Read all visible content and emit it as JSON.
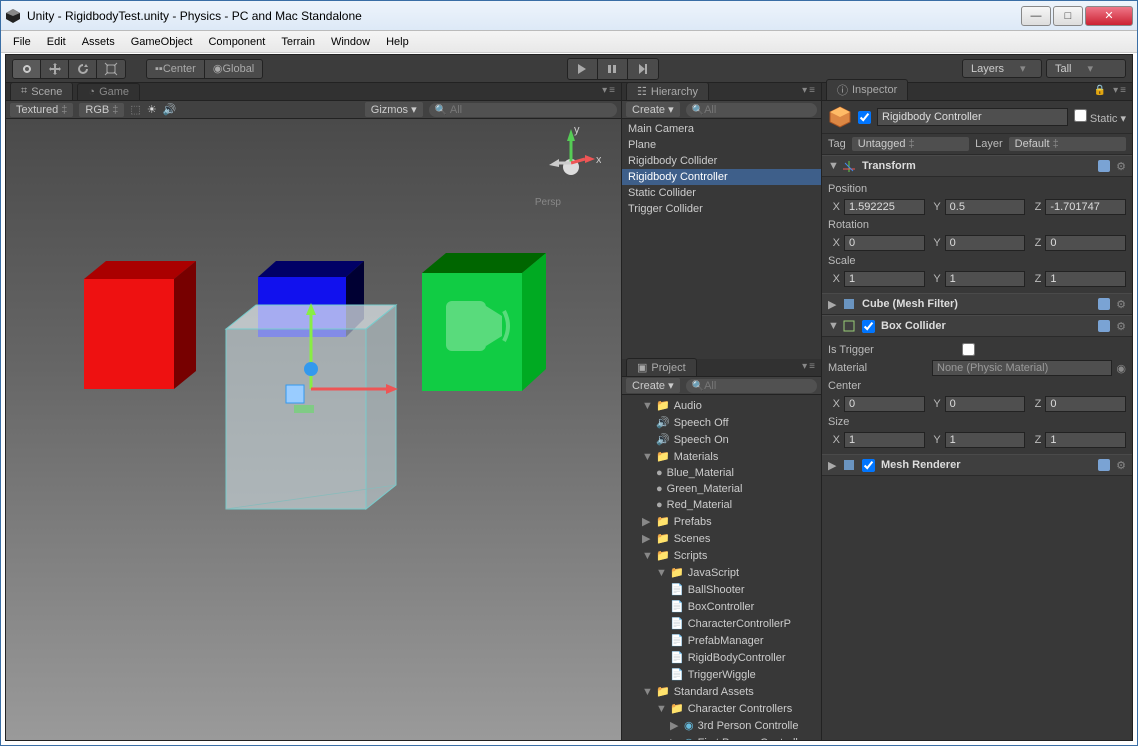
{
  "window": {
    "title": "Unity - RigidbodyTest.unity - Physics - PC and Mac Standalone"
  },
  "menu": [
    "File",
    "Edit",
    "Assets",
    "GameObject",
    "Component",
    "Terrain",
    "Window",
    "Help"
  ],
  "toolbar": {
    "center": "Center",
    "global": "Global",
    "layers": "Layers",
    "layout": "Tall"
  },
  "scene": {
    "tab_scene": "Scene",
    "tab_game": "Game",
    "shading": "Textured",
    "render": "RGB",
    "gizmos": "Gizmos",
    "search_placeholder": "All",
    "persp": "Persp",
    "axis_x": "x",
    "axis_y": "y"
  },
  "hierarchy": {
    "title": "Hierarchy",
    "create": "Create",
    "search_placeholder": "All",
    "items": [
      {
        "label": "Main Camera"
      },
      {
        "label": "Plane"
      },
      {
        "label": "Rigidbody Collider"
      },
      {
        "label": "Rigidbody Controller",
        "selected": true
      },
      {
        "label": "Static Collider"
      },
      {
        "label": "Trigger Collider"
      }
    ]
  },
  "project": {
    "title": "Project",
    "create": "Create",
    "search_placeholder": "All",
    "tree": {
      "audio": "Audio",
      "speech_off": "Speech Off",
      "speech_on": "Speech On",
      "materials": "Materials",
      "blue_mat": "Blue_Material",
      "green_mat": "Green_Material",
      "red_mat": "Red_Material",
      "prefabs": "Prefabs",
      "scenes": "Scenes",
      "scripts": "Scripts",
      "javascript": "JavaScript",
      "ballshooter": "BallShooter",
      "boxcontroller": "BoxController",
      "charctrl": "CharacterControllerP",
      "prefabmgr": "PrefabManager",
      "rigidctrl": "RigidBodyController",
      "triggerwig": "TriggerWiggle",
      "stdassets": "Standard Assets",
      "charctrls": "Character Controllers",
      "thirdperson": "3rd Person Controlle",
      "firstperson": "First Person Controll"
    }
  },
  "inspector": {
    "title": "Inspector",
    "object_name": "Rigidbody Controller",
    "static_label": "Static",
    "tag_label": "Tag",
    "tag_value": "Untagged",
    "layer_label": "Layer",
    "layer_value": "Default",
    "transform": {
      "title": "Transform",
      "position_label": "Position",
      "rotation_label": "Rotation",
      "scale_label": "Scale",
      "pos": {
        "x": "1.592225",
        "y": "0.5",
        "z": "-1.701747"
      },
      "rot": {
        "x": "0",
        "y": "0",
        "z": "0"
      },
      "scale": {
        "x": "1",
        "y": "1",
        "z": "1"
      }
    },
    "mesh_filter": {
      "title": "Cube (Mesh Filter)"
    },
    "box_collider": {
      "title": "Box Collider",
      "is_trigger_label": "Is Trigger",
      "material_label": "Material",
      "material_value": "None (Physic Material)",
      "center_label": "Center",
      "size_label": "Size",
      "center": {
        "x": "0",
        "y": "0",
        "z": "0"
      },
      "size": {
        "x": "1",
        "y": "1",
        "z": "1"
      }
    },
    "mesh_renderer": {
      "title": "Mesh Renderer"
    },
    "axis": {
      "x": "X",
      "y": "Y",
      "z": "Z"
    }
  }
}
